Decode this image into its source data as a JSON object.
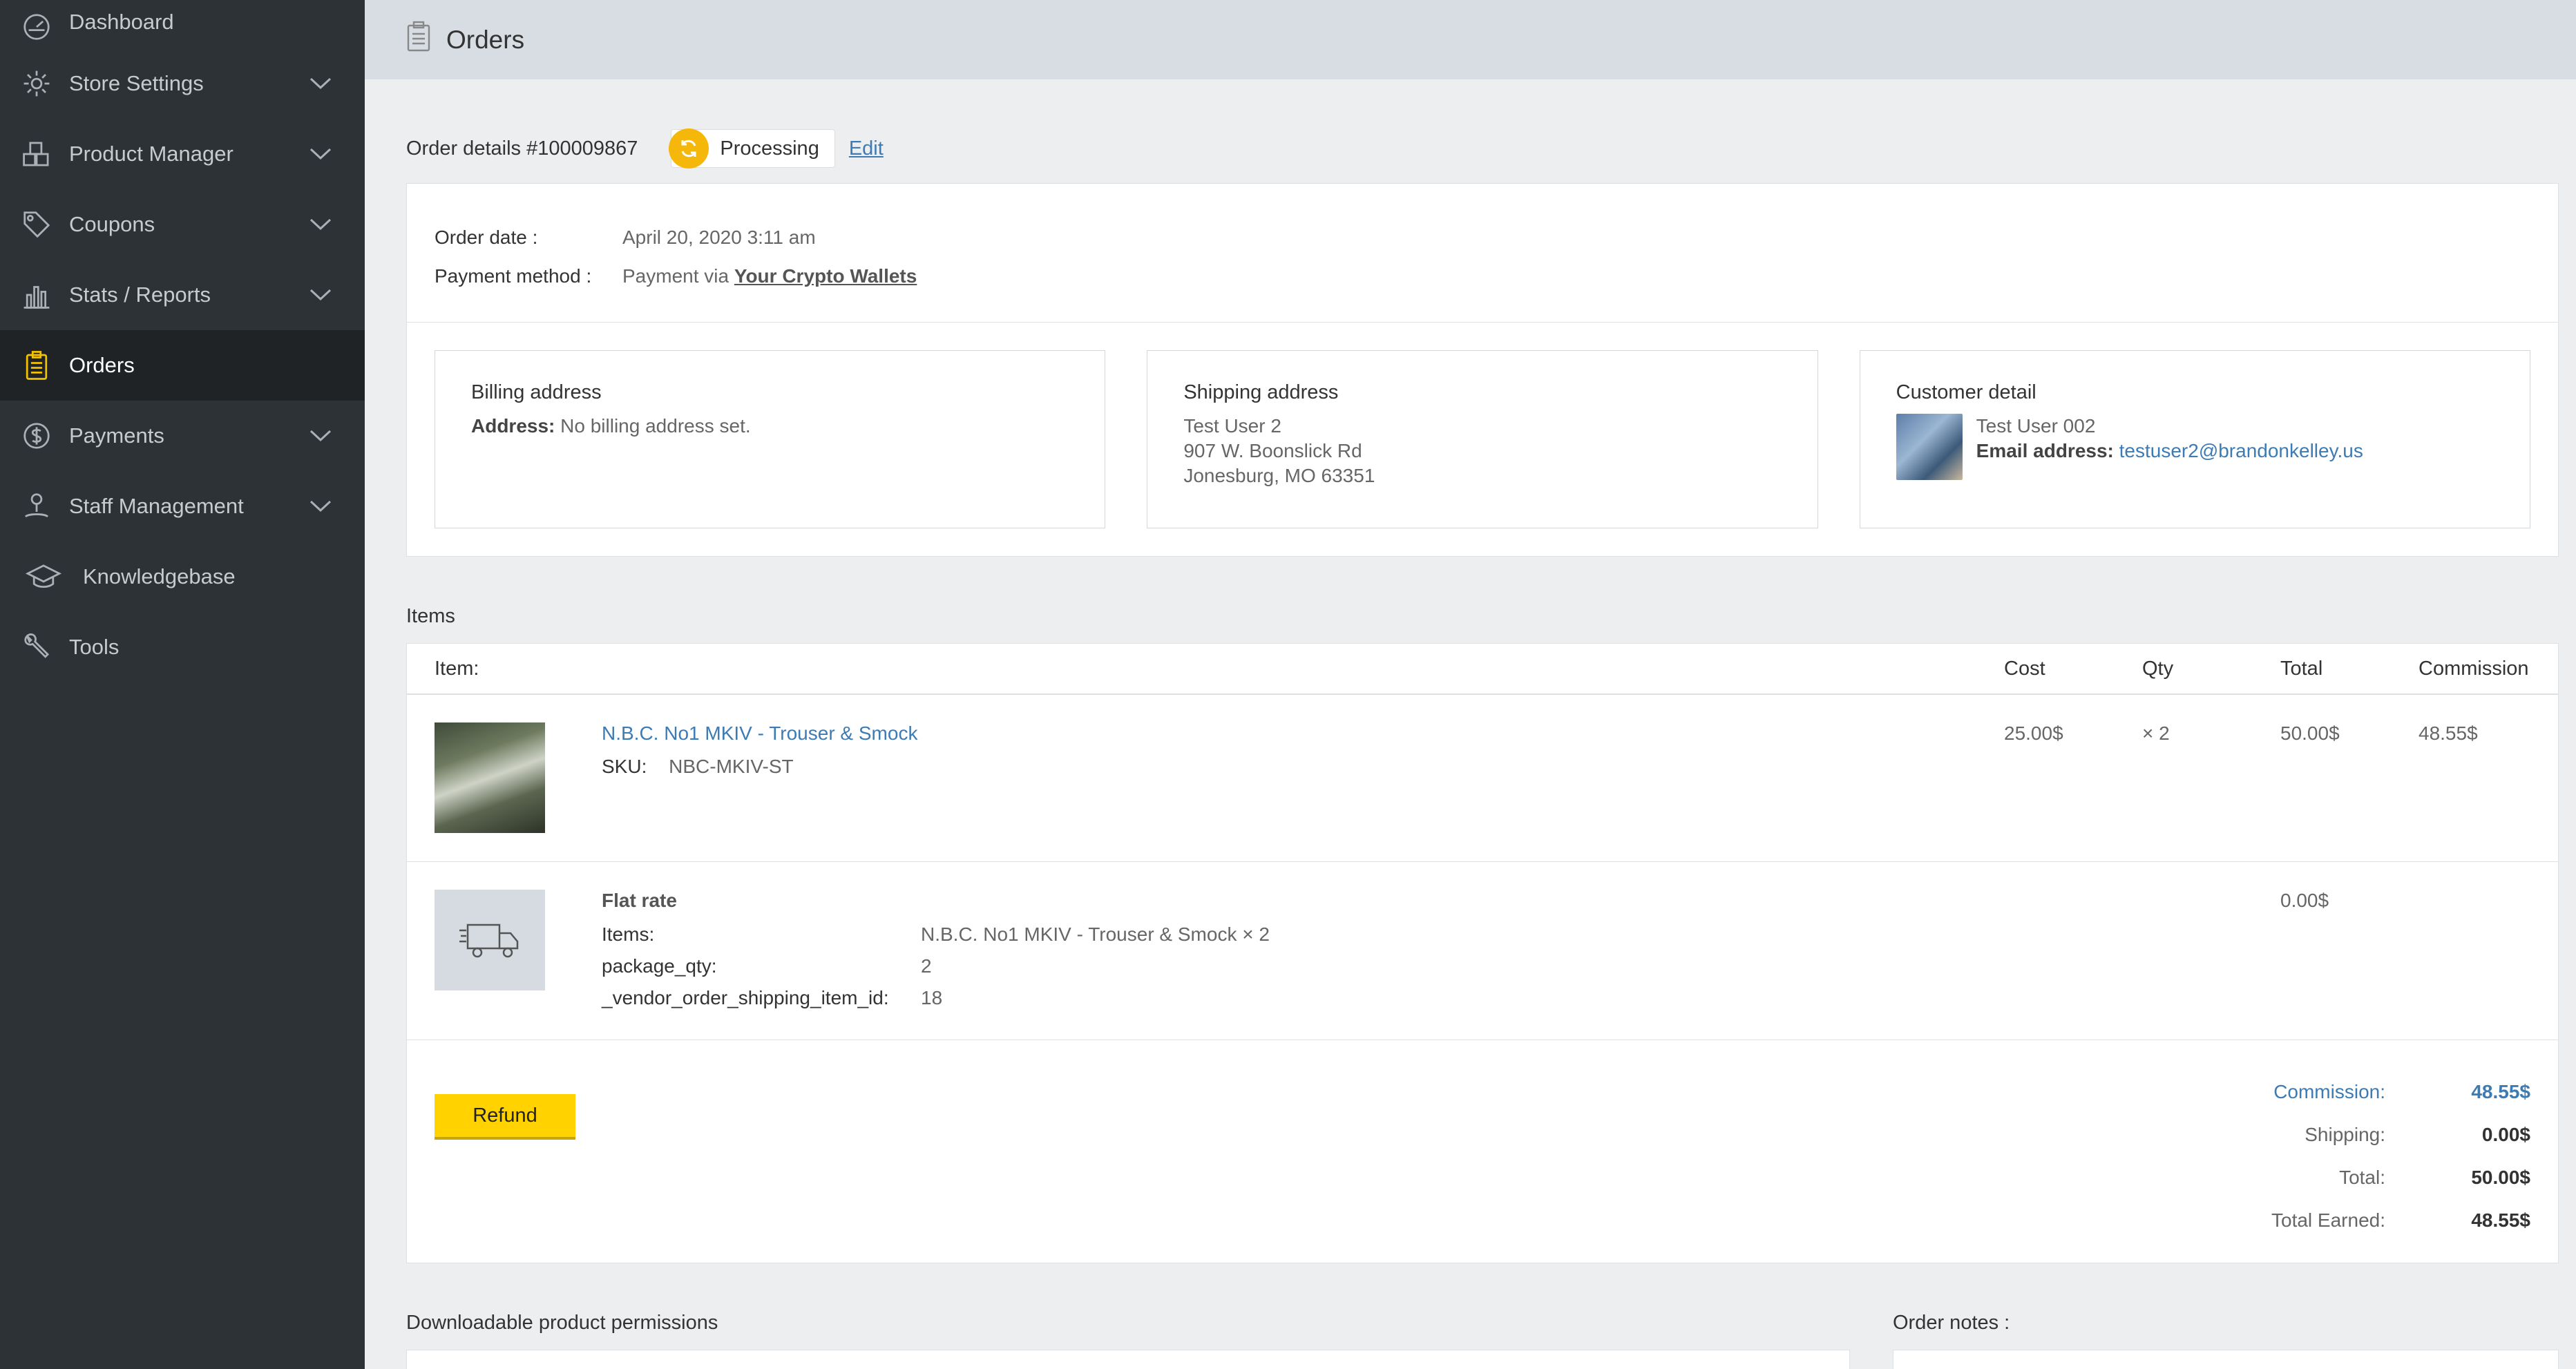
{
  "sidebar": {
    "items": [
      {
        "label": "Dashboard",
        "icon": "dashboard-icon",
        "has_chevron": false
      },
      {
        "label": "Store Settings",
        "icon": "gear-icon",
        "has_chevron": true
      },
      {
        "label": "Product Manager",
        "icon": "boxes-icon",
        "has_chevron": true
      },
      {
        "label": "Coupons",
        "icon": "tag-icon",
        "has_chevron": true
      },
      {
        "label": "Stats / Reports",
        "icon": "bar-chart-icon",
        "has_chevron": true
      },
      {
        "label": "Orders",
        "icon": "clipboard-icon",
        "has_chevron": false,
        "active": true
      },
      {
        "label": "Payments",
        "icon": "dollar-icon",
        "has_chevron": true
      },
      {
        "label": "Staff Management",
        "icon": "user-pin-icon",
        "has_chevron": true
      },
      {
        "label": "Knowledgebase",
        "icon": "graduation-cap-icon",
        "has_chevron": false
      },
      {
        "label": "Tools",
        "icon": "wrench-icon",
        "has_chevron": false
      }
    ]
  },
  "header": {
    "title": "Orders"
  },
  "order": {
    "title": "Order details #100009867",
    "status": "Processing",
    "edit_label": "Edit",
    "date_label": "Order date :",
    "date_value": "April 20, 2020 3:11 am",
    "payment_label": "Payment method :",
    "payment_prefix": "Payment via",
    "payment_link": "Your Crypto Wallets"
  },
  "billing": {
    "title": "Billing address",
    "address_label": "Address:",
    "address_value": "No billing address set."
  },
  "shipping": {
    "title": "Shipping address",
    "line1": "Test User 2",
    "line2": "907 W. Boonslick Rd",
    "line3": "Jonesburg, MO 63351"
  },
  "customer": {
    "title": "Customer detail",
    "name": "Test User 002",
    "email_label": "Email address:",
    "email": "testuser2@brandonkelley.us"
  },
  "items": {
    "section_title": "Items",
    "headers": {
      "item": "Item:",
      "cost": "Cost",
      "qty": "Qty",
      "total": "Total",
      "commission": "Commission"
    },
    "product": {
      "name": "N.B.C. No1 MKIV - Trouser & Smock",
      "sku_label": "SKU:",
      "sku": "NBC-MKIV-ST",
      "cost": "25.00$",
      "qty": "× 2",
      "total": "50.00$",
      "commission": "48.55$"
    },
    "shipping": {
      "title": "Flat rate",
      "items_label": "Items:",
      "items_value": "N.B.C. No1 MKIV - Trouser & Smock × 2",
      "pkg_label": "package_qty:",
      "pkg_value": "2",
      "vendor_label": "_vendor_order_shipping_item_id:",
      "vendor_value": "18",
      "total": "0.00$"
    }
  },
  "totals": {
    "refund_label": "Refund",
    "commission_label": "Commission:",
    "commission_value": "48.55$",
    "shipping_label": "Shipping:",
    "shipping_value": "0.00$",
    "total_label": "Total:",
    "total_value": "50.00$",
    "earned_label": "Total Earned:",
    "earned_value": "48.55$"
  },
  "bottom": {
    "downloads_title": "Downloadable product permissions",
    "notes_title": "Order notes :"
  },
  "colors": {
    "accent": "#3d7bb5",
    "refund": "#ffd200",
    "status": "#f5b80a",
    "sidebar": "#2d3236"
  }
}
